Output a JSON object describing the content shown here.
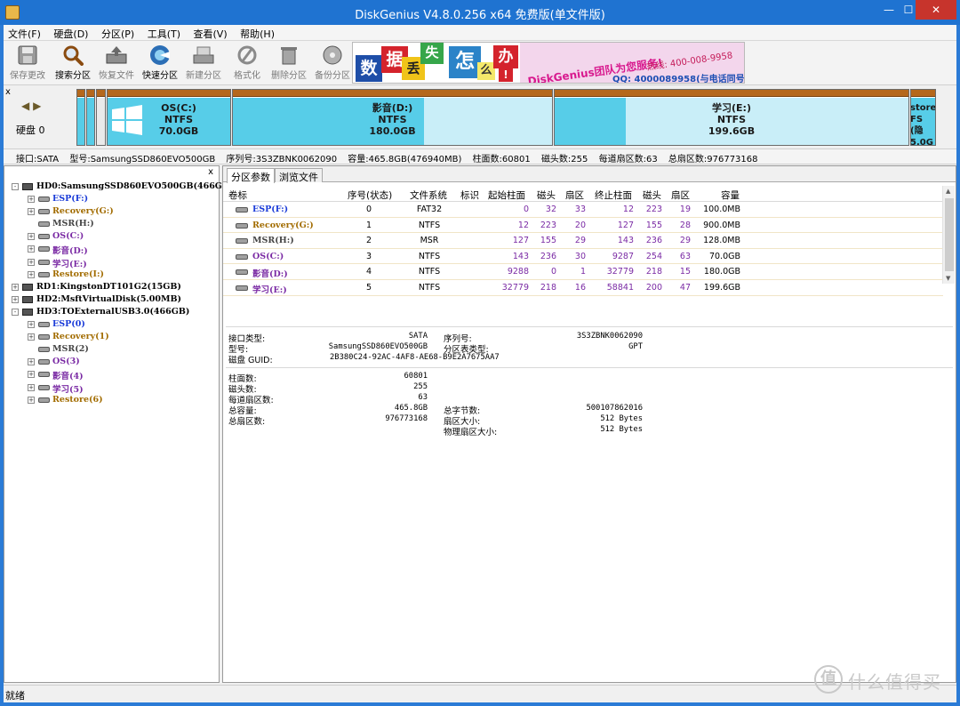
{
  "window": {
    "title": "DiskGenius V4.8.0.256 x64 免费版(单文件版)",
    "min": "—",
    "max": "☐",
    "close": "✕"
  },
  "menu": [
    "文件(F)",
    "硬盘(D)",
    "分区(P)",
    "工具(T)",
    "查看(V)",
    "帮助(H)"
  ],
  "toolbar": [
    {
      "label": "保存更改",
      "icon": "save-icon",
      "enabled": false
    },
    {
      "label": "搜索分区",
      "icon": "search-icon",
      "enabled": true
    },
    {
      "label": "恢复文件",
      "icon": "recover-icon",
      "enabled": false
    },
    {
      "label": "快速分区",
      "icon": "quick-partition-icon",
      "enabled": true
    },
    {
      "label": "新建分区",
      "icon": "new-partition-icon",
      "enabled": false
    },
    {
      "label": "格式化",
      "icon": "format-icon",
      "enabled": false
    },
    {
      "label": "删除分区",
      "icon": "delete-icon",
      "enabled": false
    },
    {
      "label": "备份分区",
      "icon": "backup-icon",
      "enabled": false
    }
  ],
  "banner": {
    "chars": [
      "数",
      "据",
      "丢",
      "失",
      "怎",
      "么",
      "办",
      "!"
    ],
    "brand": "DiskGenius团队为您服务!",
    "hotline": "热线: 400-008-9958",
    "qq": "QQ: 4000089958(与电话同号)"
  },
  "diskmap": {
    "close": "x",
    "nav_left": "◀",
    "nav_right": "▶",
    "disk_label": "硬盘 0",
    "partitions": [
      {
        "name": "OS(C:)",
        "fs": "NTFS",
        "size": "70.0GB",
        "used_fraction": 1.0
      },
      {
        "name": "影音(D:)",
        "fs": "NTFS",
        "size": "180.0GB",
        "used_fraction": 0.6
      },
      {
        "name": "学习(E:)",
        "fs": "NTFS",
        "size": "199.6GB",
        "used_fraction": 0.2
      },
      {
        "name": "store(",
        "fs": "FS (隐",
        "size": "5.0G",
        "used_fraction": 1.0
      }
    ]
  },
  "diskinfo": {
    "interface": "接口:SATA",
    "model": "型号:SamsungSSD860EVO500GB",
    "serial": "序列号:3S3ZBNK0062090",
    "capacity": "容量:465.8GB(476940MB)",
    "cylinders": "柱面数:60801",
    "heads": "磁头数:255",
    "sectors_per_track": "每道扇区数:63",
    "total_sectors": "总扇区数:976773168"
  },
  "tree": {
    "close": "x",
    "items": [
      {
        "text": "HD0:SamsungSSD860EVO500GB(466GB)",
        "level": 0,
        "type": "disk",
        "expander": "-",
        "color": "c-gray"
      },
      {
        "text": "ESP(F:)",
        "level": 1,
        "type": "part",
        "expander": "+",
        "color": "c-blue"
      },
      {
        "text": "Recovery(G:)",
        "level": 1,
        "type": "part",
        "expander": "+",
        "color": "c-gold"
      },
      {
        "text": "MSR(H:)",
        "level": 1,
        "type": "part",
        "expander": "",
        "color": "c-gray"
      },
      {
        "text": "OS(C:)",
        "level": 1,
        "type": "part",
        "expander": "+",
        "color": "c-purple"
      },
      {
        "text": "影音(D:)",
        "level": 1,
        "type": "part",
        "expander": "+",
        "color": "c-purple"
      },
      {
        "text": "学习(E:)",
        "level": 1,
        "type": "part",
        "expander": "+",
        "color": "c-purple"
      },
      {
        "text": "Restore(I:)",
        "level": 1,
        "type": "part",
        "expander": "+",
        "color": "c-gold"
      },
      {
        "text": "RD1:KingstonDT101G2(15GB)",
        "level": 0,
        "type": "disk",
        "expander": "+",
        "color": "c-gray"
      },
      {
        "text": "HD2:MsftVirtualDisk(5.00MB)",
        "level": 0,
        "type": "disk",
        "expander": "+",
        "color": "c-gray"
      },
      {
        "text": "HD3:TOExternalUSB3.0(466GB)",
        "level": 0,
        "type": "disk",
        "expander": "-",
        "color": "c-gray"
      },
      {
        "text": "ESP(0)",
        "level": 1,
        "type": "part",
        "expander": "+",
        "color": "c-blue"
      },
      {
        "text": "Recovery(1)",
        "level": 1,
        "type": "part",
        "expander": "+",
        "color": "c-gold"
      },
      {
        "text": "MSR(2)",
        "level": 1,
        "type": "part",
        "expander": "",
        "color": "c-gray"
      },
      {
        "text": "OS(3)",
        "level": 1,
        "type": "part",
        "expander": "+",
        "color": "c-purple"
      },
      {
        "text": "影音(4)",
        "level": 1,
        "type": "part",
        "expander": "+",
        "color": "c-purple"
      },
      {
        "text": "学习(5)",
        "level": 1,
        "type": "part",
        "expander": "+",
        "color": "c-purple"
      },
      {
        "text": "Restore(6)",
        "level": 1,
        "type": "part",
        "expander": "+",
        "color": "c-gold"
      }
    ]
  },
  "tabs": [
    "分区参数",
    "浏览文件"
  ],
  "ptable": {
    "headers": [
      "卷标",
      "序号(状态)",
      "文件系统",
      "标识",
      "起始柱面",
      "磁头",
      "扇区",
      "终止柱面",
      "磁头",
      "扇区",
      "容量"
    ],
    "rows": [
      {
        "label": "ESP(F:)",
        "color": "c-blue",
        "idx": "0",
        "fs": "FAT32",
        "flag": "",
        "sc": "0",
        "sh": "32",
        "ss": "33",
        "ec": "12",
        "eh": "223",
        "es": "19",
        "cap": "100.0MB"
      },
      {
        "label": "Recovery(G:)",
        "color": "c-gold",
        "idx": "1",
        "fs": "NTFS",
        "flag": "",
        "sc": "12",
        "sh": "223",
        "ss": "20",
        "ec": "127",
        "eh": "155",
        "es": "28",
        "cap": "900.0MB"
      },
      {
        "label": "MSR(H:)",
        "color": "c-gray",
        "idx": "2",
        "fs": "MSR",
        "flag": "",
        "sc": "127",
        "sh": "155",
        "ss": "29",
        "ec": "143",
        "eh": "236",
        "es": "29",
        "cap": "128.0MB"
      },
      {
        "label": "OS(C:)",
        "color": "c-purple",
        "idx": "3",
        "fs": "NTFS",
        "flag": "",
        "sc": "143",
        "sh": "236",
        "ss": "30",
        "ec": "9287",
        "eh": "254",
        "es": "63",
        "cap": "70.0GB"
      },
      {
        "label": "影音(D:)",
        "color": "c-purple",
        "idx": "4",
        "fs": "NTFS",
        "flag": "",
        "sc": "9288",
        "sh": "0",
        "ss": "1",
        "ec": "32779",
        "eh": "218",
        "es": "15",
        "cap": "180.0GB"
      },
      {
        "label": "学习(E:)",
        "color": "c-purple",
        "idx": "5",
        "fs": "NTFS",
        "flag": "",
        "sc": "32779",
        "sh": "218",
        "ss": "16",
        "ec": "58841",
        "eh": "200",
        "es": "47",
        "cap": "199.6GB"
      }
    ]
  },
  "details": {
    "interface_type_label": "接口类型:",
    "interface_type": "SATA",
    "serial_label": "序列号:",
    "serial": "3S3ZBNK0062090",
    "model_label": "型号:",
    "model": "SamsungSSD860EVO500GB",
    "table_type_label": "分区表类型:",
    "table_type": "GPT",
    "guid_label": "磁盘 GUID:",
    "guid": "2B380C24-92AC-4AF8-AE68-B9E2A7675AA7",
    "cylinders_label": "柱面数:",
    "cylinders": "60801",
    "heads_label": "磁头数:",
    "heads": "255",
    "spt_label": "每道扇区数:",
    "spt": "63",
    "capacity_label": "总容量:",
    "capacity": "465.8GB",
    "total_bytes_label": "总字节数:",
    "total_bytes": "500107862016",
    "total_sectors_label": "总扇区数:",
    "total_sectors": "976773168",
    "sector_size_label": "扇区大小:",
    "sector_size": "512 Bytes",
    "physical_sector_label": "物理扇区大小:",
    "physical_sector": "512 Bytes"
  },
  "status": "就绪",
  "watermark": {
    "logo": "值",
    "text": "什么值得买"
  }
}
